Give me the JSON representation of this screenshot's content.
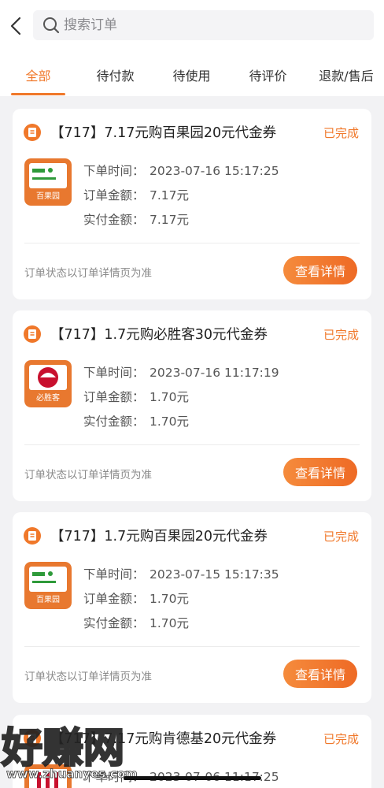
{
  "search": {
    "placeholder": "搜索订单"
  },
  "tabs": [
    "全部",
    "待付款",
    "待使用",
    "待评价",
    "退款/售后"
  ],
  "accent_color": "#f0782a",
  "orders": [
    {
      "title": "【717】7.17元购百果园20元代金券",
      "status": "已完成",
      "logo": {
        "icon": "baiguoyuan-logo",
        "text": "百果园"
      },
      "labels": [
        "下单时间：",
        "订单金额：",
        "实付金额："
      ],
      "order_time": "2023-07-16 15:17:25",
      "order_amount": "7.17元",
      "paid_amount": "7.17元",
      "note": "订单状态以订单详情页为准",
      "button": "查看详情"
    },
    {
      "title": "【717】1.7元购必胜客30元代金券",
      "status": "已完成",
      "logo": {
        "icon": "pizzahut-logo",
        "text": "必胜客"
      },
      "labels": [
        "下单时间：",
        "订单金额：",
        "实付金额："
      ],
      "order_time": "2023-07-16 11:17:19",
      "order_amount": "1.70元",
      "paid_amount": "1.70元",
      "note": "订单状态以订单详情页为准",
      "button": "查看详情"
    },
    {
      "title": "【717】1.7元购百果园20元代金券",
      "status": "已完成",
      "logo": {
        "icon": "baiguoyuan-logo",
        "text": "百果园"
      },
      "labels": [
        "下单时间：",
        "订单金额：",
        "实付金额："
      ],
      "order_time": "2023-07-15 15:17:35",
      "order_amount": "1.70元",
      "paid_amount": "1.70元",
      "note": "订单状态以订单详情页为准",
      "button": "查看详情"
    },
    {
      "title": "【717】7.17元购肯德基20元代金券",
      "status": "已完成",
      "logo": {
        "icon": "kfc-logo",
        "text": ""
      },
      "labels": [
        "下单时间：",
        "订单金额：",
        "实付金额："
      ],
      "order_time": "2023-07-06 11:17:25",
      "order_amount": "",
      "paid_amount": "",
      "note": "",
      "button": ""
    }
  ],
  "watermark": {
    "text": "好赚网",
    "url": "www.zhuanyes.com"
  }
}
